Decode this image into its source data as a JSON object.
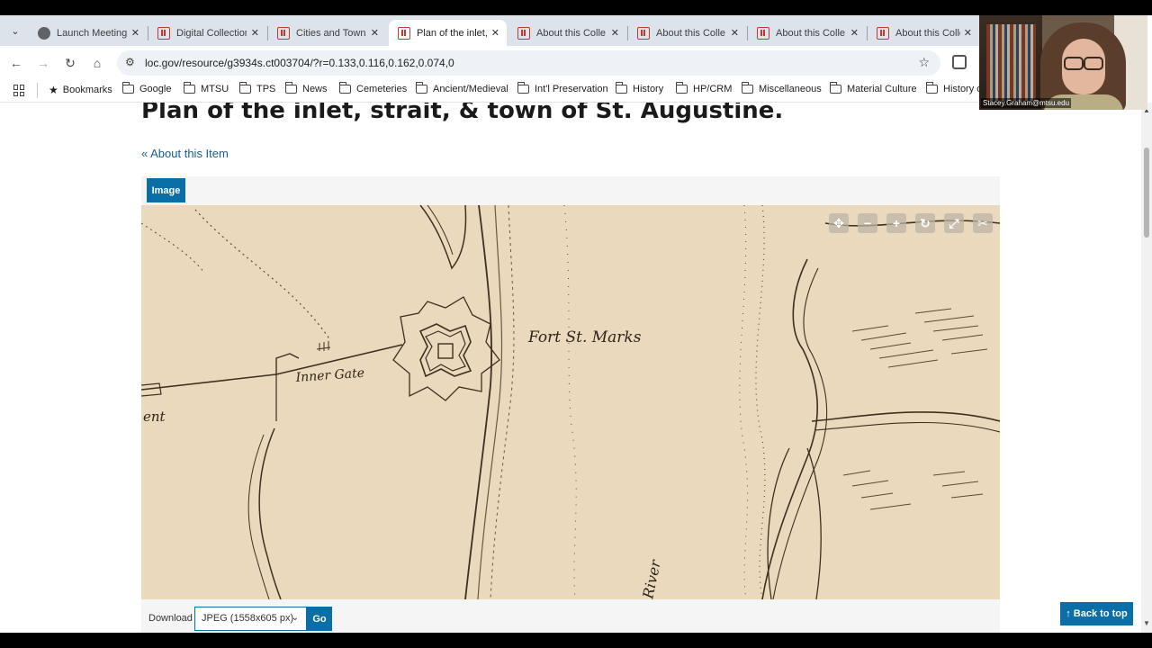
{
  "tabs": [
    {
      "title": "Launch Meeting",
      "icon": "globe-icon",
      "active": false
    },
    {
      "title": "Digital Collection",
      "icon": "loc-favicon-icon",
      "active": false
    },
    {
      "title": "Cities and Towns",
      "icon": "loc-favicon-icon",
      "active": false
    },
    {
      "title": "Plan of the inlet,",
      "icon": "loc-favicon-icon",
      "active": true
    },
    {
      "title": "About this Colle",
      "icon": "loc-favicon-icon",
      "active": false
    },
    {
      "title": "About this Colle",
      "icon": "loc-favicon-icon",
      "active": false
    },
    {
      "title": "About this Colle",
      "icon": "loc-favicon-icon",
      "active": false
    },
    {
      "title": "About this Colle",
      "icon": "loc-favicon-icon",
      "active": false
    }
  ],
  "address_bar": {
    "url": "loc.gov/resource/g3934s.ct003704/?r=0.133,0.116,0.162,0.074,0"
  },
  "bookmarks": [
    {
      "label": "Bookmarks",
      "icon": "star-icon"
    },
    {
      "label": "Google",
      "icon": "folder-icon"
    },
    {
      "label": "MTSU",
      "icon": "folder-icon"
    },
    {
      "label": "TPS",
      "icon": "folder-icon"
    },
    {
      "label": "News",
      "icon": "folder-icon"
    },
    {
      "label": "Cemeteries",
      "icon": "folder-icon"
    },
    {
      "label": "Ancient/Medieval",
      "icon": "folder-icon"
    },
    {
      "label": "Int'l Preservation",
      "icon": "folder-icon"
    },
    {
      "label": "History",
      "icon": "folder-icon"
    },
    {
      "label": "HP/CRM",
      "icon": "folder-icon"
    },
    {
      "label": "Miscellaneous",
      "icon": "folder-icon"
    },
    {
      "label": "Material Culture",
      "icon": "folder-icon"
    },
    {
      "label": "History o",
      "icon": "folder-icon"
    }
  ],
  "page": {
    "title": "Plan of the inlet, strait, & town of St. Augustine.",
    "back_link": "« About this Item",
    "viewer_tab": "Image",
    "map_labels": {
      "fort": "Fort St. Marks",
      "gate": "Inner Gate",
      "fragment": "ent",
      "river": "River"
    },
    "download": {
      "label": "Download",
      "selected_format": "JPEG (1558x605 px)",
      "go_label": "Go"
    },
    "back_to_top": "Back to top"
  },
  "webcam": {
    "participant": "Stacey.Graham@mtsu.edu"
  },
  "colors": {
    "accent": "#0a6fa6",
    "map_paper": "#ead9bd",
    "link": "#1a5d8f"
  }
}
